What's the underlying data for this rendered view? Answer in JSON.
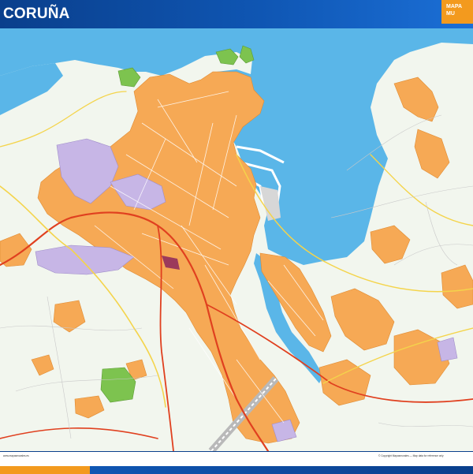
{
  "header": {
    "title": "CORUÑA",
    "brand_line1": "MAPA",
    "brand_line2": "MU"
  },
  "colors": {
    "header_blue": "#0f56b3",
    "brand_orange": "#f39a1e",
    "sea": "#5ab6e8",
    "land": "#f2f6ee",
    "urban": "#f6a955",
    "industrial": "#c7b6e6",
    "park": "#7dc34f",
    "highway": "#e0401f"
  },
  "footer": {
    "left_note": "www.mapasmurales.es",
    "right_note": "© Copyright Mapasmurales — Map data for reference only"
  }
}
